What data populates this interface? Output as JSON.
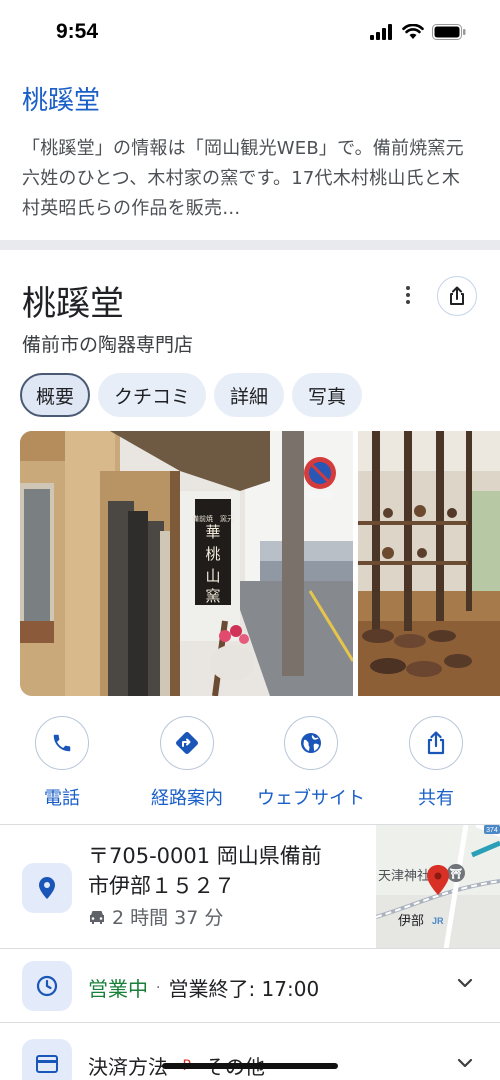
{
  "status_bar": {
    "time": "9:54"
  },
  "result": {
    "title": "桃蹊堂",
    "snippet": "「桃蹊堂」の情報は「岡山観光WEB」で。備前焼窯元六姓のひとつ、木村家の窯です。17代木村桃山氏と木村英昭氏らの作品を販売…"
  },
  "knowledge_panel": {
    "title": "桃蹊堂",
    "subtitle": "備前市の陶器専門店",
    "tabs": [
      "概要",
      "クチコミ",
      "詳細",
      "写真"
    ],
    "active_tab": 0,
    "photo_sign": "華桃山窯",
    "photo_sign_small": "備前焼　窯元",
    "actions": [
      {
        "label": "電話",
        "icon": "phone-icon"
      },
      {
        "label": "経路案内",
        "icon": "directions-icon"
      },
      {
        "label": "ウェブサイト",
        "icon": "globe-icon"
      },
      {
        "label": "共有",
        "icon": "share-icon"
      }
    ],
    "address": {
      "line1": "〒705-0001 岡山県備前",
      "line2": "市伊部１５２７",
      "travel_time": "2 時間 37 分",
      "map_labels": {
        "shrine": "天津神社",
        "station": "伊部",
        "jr": "JR",
        "route": "374"
      }
    },
    "hours": {
      "status": "営業中",
      "separator": "·",
      "closing": "営業終了: 17:00"
    },
    "payment": {
      "label": "決済方法",
      "value": "その他"
    }
  },
  "colors": {
    "link_blue": "#1a5fc7",
    "open_green": "#188038",
    "icon_blue": "#1a56b8",
    "pin_red": "#d93025"
  }
}
